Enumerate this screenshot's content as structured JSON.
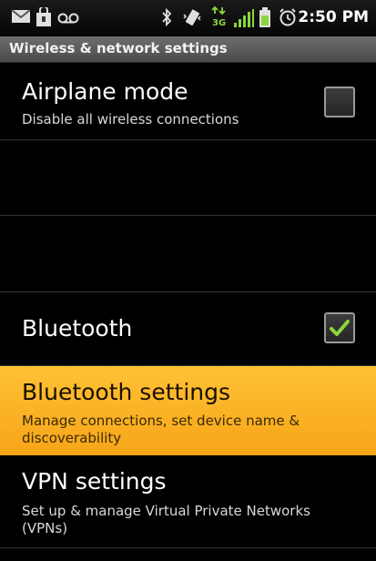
{
  "status_bar": {
    "time": "2:50 PM",
    "icons": [
      "gmail-icon",
      "notification-icon",
      "voicemail-icon",
      "bluetooth-icon",
      "vibrate-icon",
      "data-3g-icon",
      "signal-icon",
      "battery-icon",
      "alarm-icon"
    ]
  },
  "header": {
    "title": "Wireless & network settings"
  },
  "settings": {
    "airplane": {
      "title": "Airplane mode",
      "subtitle": "Disable all wireless connections",
      "checked": false
    },
    "bluetooth": {
      "title": "Bluetooth",
      "checked": true
    },
    "bluetooth_settings": {
      "title": "Bluetooth settings",
      "subtitle": "Manage connections, set device name & discoverability"
    },
    "vpn": {
      "title": "VPN settings",
      "subtitle": "Set up & manage Virtual Private Networks (VPNs)"
    }
  },
  "colors": {
    "highlight": "#f9ad1f",
    "check_green": "#8ad63c",
    "background": "#000000"
  }
}
